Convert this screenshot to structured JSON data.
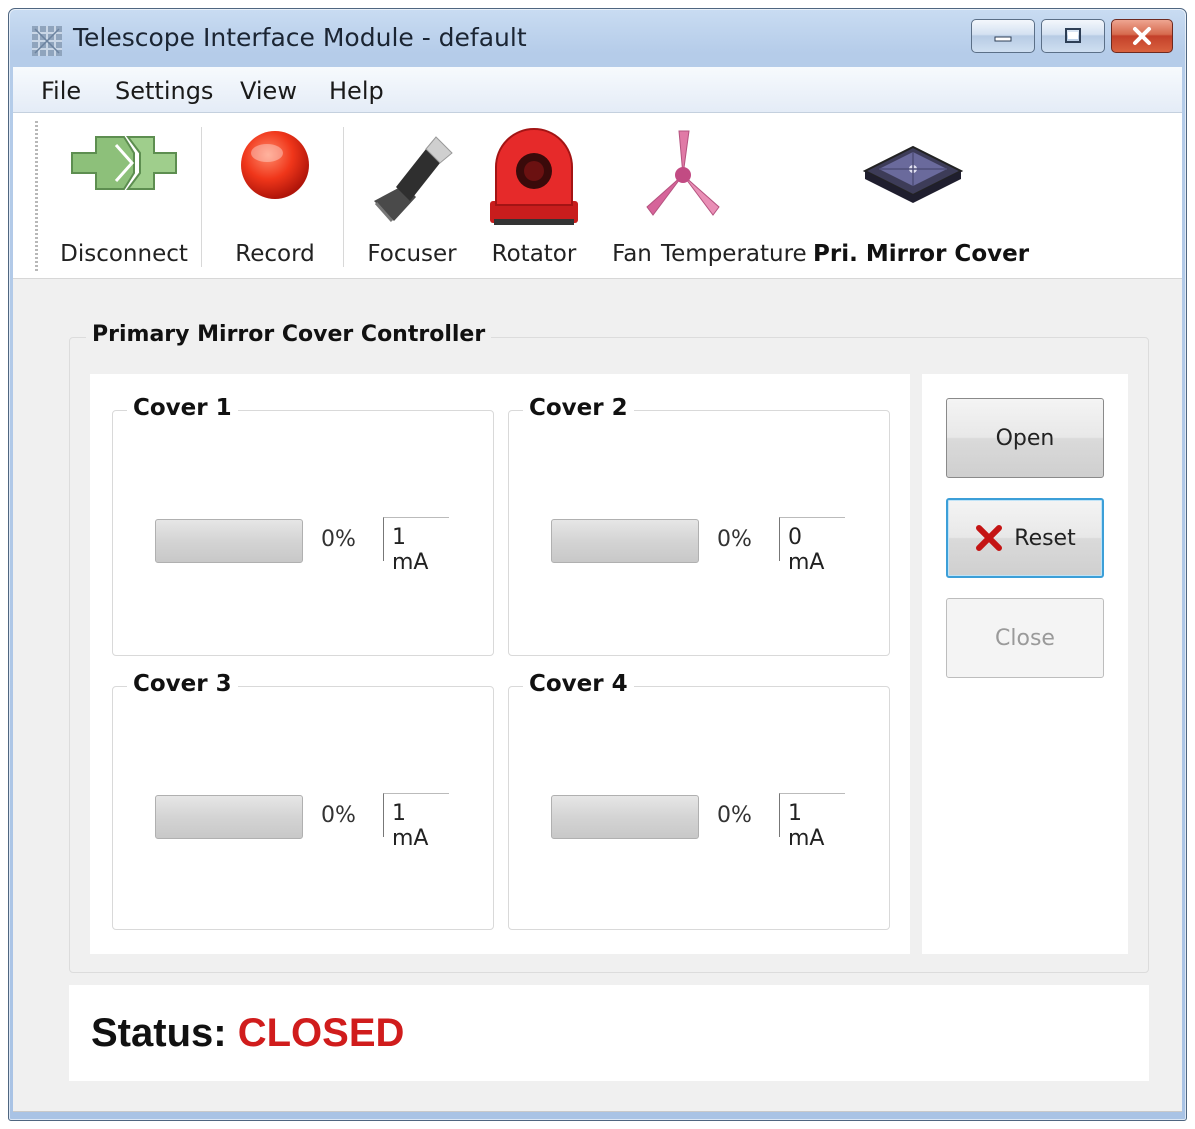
{
  "window": {
    "title": "Telescope Interface Module - default"
  },
  "menu": [
    "File",
    "Settings",
    "View",
    "Help"
  ],
  "toolbar": {
    "items": [
      {
        "label": "Disconnect",
        "icon": "disconnect-icon"
      },
      {
        "label": "Record",
        "icon": "record-icon"
      },
      {
        "label": "Focuser",
        "icon": "focuser-icon"
      },
      {
        "label": "Rotator",
        "icon": "rotator-icon"
      },
      {
        "label": "Fan",
        "icon": "fan-icon"
      },
      {
        "label": "Temperature",
        "icon": ""
      },
      {
        "label": "Pri. Mirror Cover",
        "icon": "mirror-cover-icon",
        "active": true
      }
    ]
  },
  "controller": {
    "title": "Primary Mirror Cover Controller",
    "covers": [
      {
        "name": "Cover 1",
        "progress_percent": 0,
        "percent_text": "0%",
        "current": "1 mA"
      },
      {
        "name": "Cover 2",
        "progress_percent": 0,
        "percent_text": "0%",
        "current": "0 mA"
      },
      {
        "name": "Cover 3",
        "progress_percent": 0,
        "percent_text": "0%",
        "current": "1 mA"
      },
      {
        "name": "Cover 4",
        "progress_percent": 0,
        "percent_text": "0%",
        "current": "1 mA"
      }
    ],
    "buttons": {
      "open": "Open",
      "reset": "Reset",
      "close": "Close"
    }
  },
  "status": {
    "label": "Status:",
    "value": "CLOSED",
    "value_color": "#d01c1c"
  }
}
